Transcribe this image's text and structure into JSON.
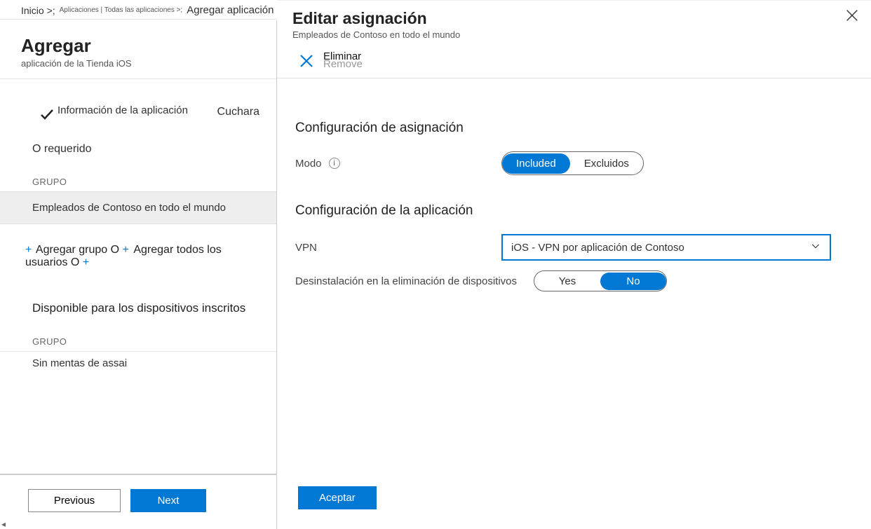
{
  "breadcrumb": {
    "item1": "Inicio >;",
    "item2": "Aplicaciones | Todas las aplicaciones >;",
    "item3": "Agregar aplicación"
  },
  "left": {
    "title": "Agregar",
    "subtitle": "aplicación de la Tienda iOS",
    "step1": "Información de la aplicación",
    "step_extra": "Cuchara",
    "required": "O requerido",
    "group_label": "GRUPO",
    "group_item": "Empleados de Contoso en todo el mundo",
    "add_group": "Agregar grupo O",
    "add_all_users": "Agregar todos los usuarios O",
    "available_enrolled": "Disponible para los dispositivos inscritos",
    "group_label2": "GRUPO",
    "no_assignments": "Sin mentas de assai",
    "prev": "Previous",
    "next": "Next"
  },
  "right": {
    "title": "Editar asignación",
    "subtitle": "Empleados de Contoso en todo el mundo",
    "remove1": "Eliminar",
    "remove2": "Remove",
    "section1": "Configuración de asignación",
    "mode_label": "Modo",
    "mode_included": "Included",
    "mode_excluded": "Excluidos",
    "section2": "Configuración de la aplicación",
    "vpn_label": "VPN",
    "vpn_value": "iOS - VPN por aplicación de Contoso",
    "uninstall_label": "Desinstalación en la eliminación de dispositivos",
    "uninstall_yes": "Yes",
    "uninstall_no": "No",
    "ok": "Aceptar"
  }
}
